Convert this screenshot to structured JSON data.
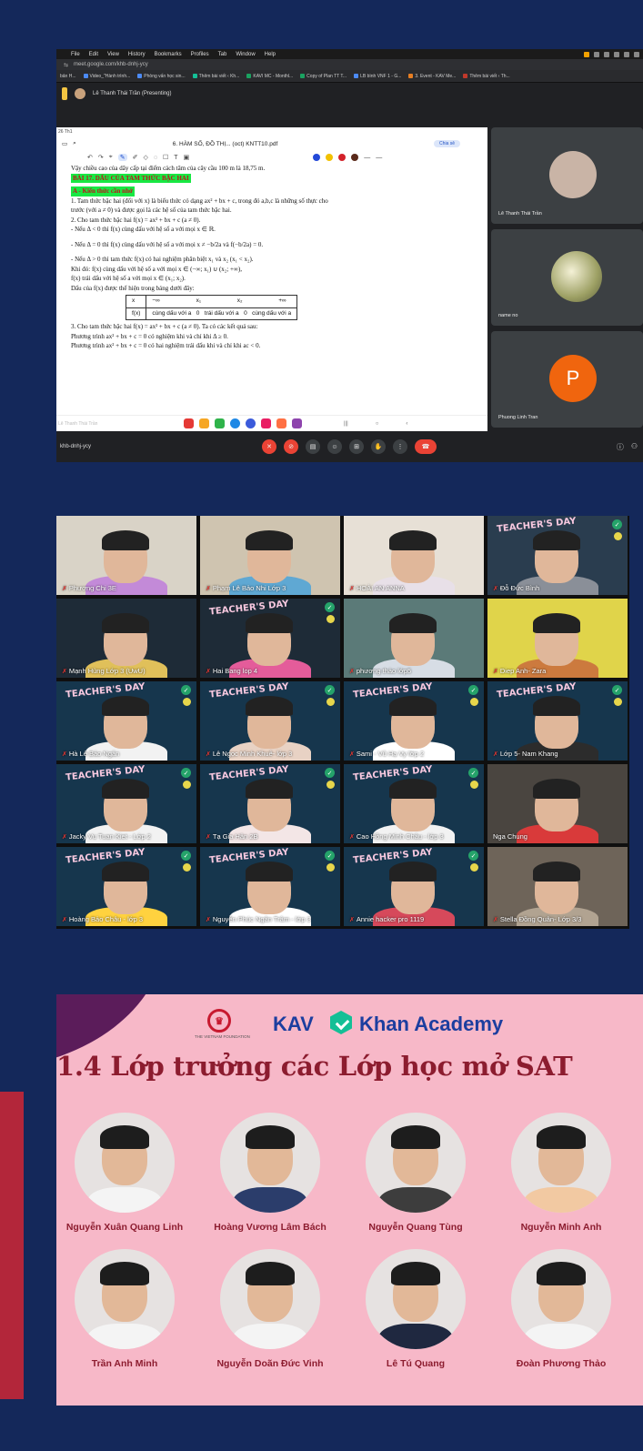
{
  "meet": {
    "menubar": [
      "File",
      "Edit",
      "View",
      "History",
      "Bookmarks",
      "Profiles",
      "Tab",
      "Window",
      "Help"
    ],
    "url": "meet.google.com/khb-dnhj-ycy",
    "bookmarks": [
      "bản H...",
      "Video_\"Hành trình...",
      "Phòng vấn học sin...",
      "Thêm bài viết ‹ Kh...",
      "KAVI MC - Monthl...",
      "Copy of Plan TT T...",
      "LB bình VNF 1 - G...",
      "3. Event - KAV Me...",
      "Thêm bài viết ‹ Th..."
    ],
    "presenting": "Lê Thanh Thái Trần (Presenting)",
    "screen": {
      "status": "26 Th1",
      "filename": "6. HÀM SỐ, ĐỒ THỊ... (oct) KNTT10.pdf",
      "share": "Chia sẻ",
      "doc_lines": [
        "Vậy chiều cao của dãy cấp tại điểm cách tâm của cây cầu 100 m là 18,75 m.",
        "1. Tam thức bậc hai (đối với x) là biểu thức có dạng ax² + bx + c, trong đó a,b,c là những số thực cho",
        "trước (với a ≠ 0) và được gọi là các hệ số của tam thức bậc hai.",
        "2. Cho tam thức bậc hai f(x) = ax² + bx + c (a ≠ 0).",
        "- Nếu Δ < 0 thì f(x) cùng dấu với hệ số a với mọi x ∈ ℝ.",
        "- Nếu Δ = 0 thì f(x) cùng dấu với hệ số a với mọi x ≠ −b/2a và f(−b/2a) = 0.",
        "- Nếu Δ > 0 thì tam thức f(x) có hai nghiệm phân biệt x₁ và x₂ (x₁ < x₂).",
        "Khi đó: f(x) cùng dấu với hệ số a với mọi x ∈ (−∞; x₁) ∪ (x₂; +∞),",
        "f(x) trái dấu với hệ số a với mọi x ∈ (x₁; x₂).",
        "Dấu của f(x) được thể hiện trong bảng dưới đây:",
        "3. Cho tam thức bậc hai f(x) = ax² + bx + c (a ≠ 0). Ta có các kết quả sau:",
        "Phương trình ax² + bx + c = 0 có nghiệm khi và chỉ khi Δ ≥ 0.",
        "Phương trình ax² + bx + c = 0 có hai nghiệm trái dấu khi và chỉ khi ac < 0."
      ],
      "heading": "BÀI 17. DẤU CỦA TAM THỨC BẬC HAI",
      "section": "A - Kiến thức cần nhớ",
      "table_row1": [
        "x",
        "−∞",
        "x₁",
        "x₂",
        "+∞"
      ],
      "table_row2": [
        "f(x)",
        "cùng dấu với a",
        "0",
        "trái dấu với a",
        "0",
        "cùng dấu với a"
      ],
      "footer_name": "Lê Thanh Thái Trần"
    },
    "tiles": [
      "Lê Thanh Thái Trần",
      "name no",
      "Phuong Linh Tran"
    ],
    "tile_letter": "P",
    "meeting_code": "khb-dnhj-ycy"
  },
  "grid": {
    "participants": [
      "Phương Chi 3E",
      "Phạm Lê Bảo Nhi Lớp 3",
      "HOÀI AN ANNA",
      "Đỗ Đức Bình",
      "Mạnh Hùng Lớp 3  (UwU)",
      "Hai Bang lop 4",
      "phương thảo lớp5",
      "Diep Anh- Zara",
      "Hà Lê Bảo Ngân",
      "Lê Ngọc Minh Khuê- lớp 3",
      "Sami - Vũ Hạ Vy lớp 2",
      "Lớp 5- Nam Khang",
      "Jacky Vu Tuan Kiet - Lớp 2",
      "Tạ Gia Hân 2B",
      "Cao Hồng Minh Châu - lớp 3",
      "Nga Chung",
      "Hoàng Bảo Châu - lớp 3",
      "Nguyễn Phúc Ngân Trâm - lớp 3",
      "Annie hacker pro 1119",
      "Stella Đồng Quân- Lớp 3/3"
    ],
    "overlay_text": "TEACHER'S DAY"
  },
  "slide": {
    "foundation": "THE VIETNAM FOUNDATION",
    "kav": "KAV",
    "khan": "Khan Academy",
    "title": "1.4 Lớp trưởng các Lớp học mở SAT",
    "people": [
      "Nguyễn Xuân Quang Linh",
      "Hoàng Vương Lâm Bách",
      "Nguyễn Quang Tùng",
      "Nguyễn Minh Anh",
      "Trần Anh Minh",
      "Nguyễn Doãn Đức Vinh",
      "Lê Tú Quang",
      "Đoàn Phương Thảo"
    ]
  }
}
